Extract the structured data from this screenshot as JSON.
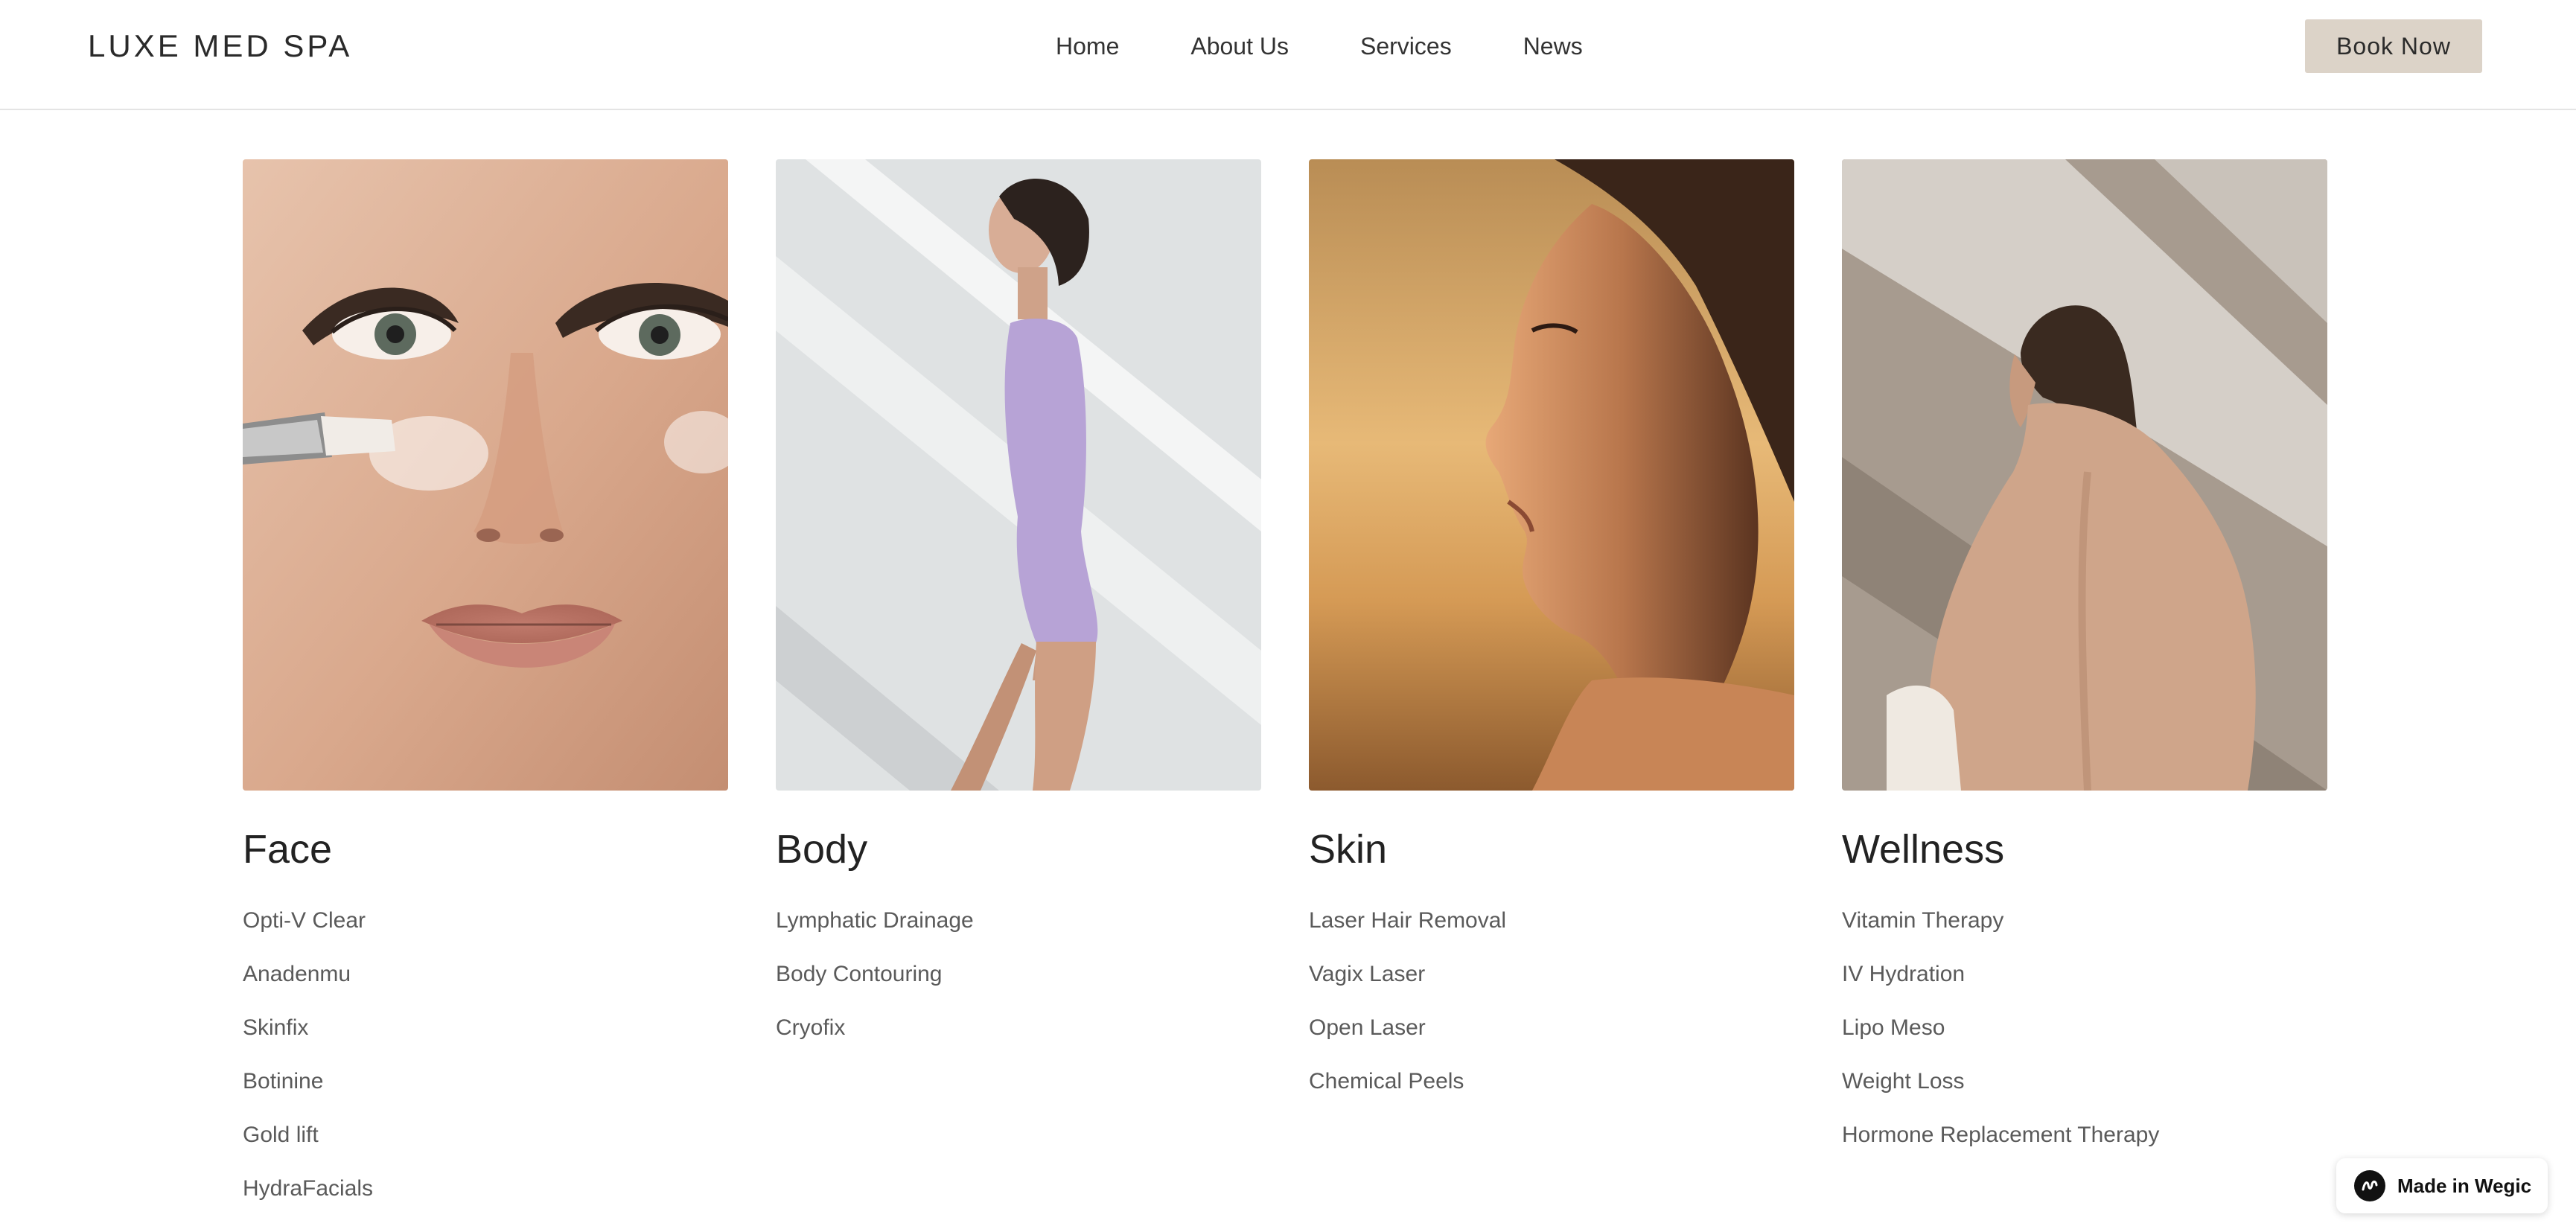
{
  "header": {
    "logo": "LUXE MED SPA",
    "nav": [
      "Home",
      "About Us",
      "Services",
      "News"
    ],
    "cta": "Book Now",
    "cta_color": "#dcd3c8"
  },
  "categories": [
    {
      "title": "Face",
      "image": "woman-face-closeup-skincare-brush",
      "items": [
        "Opti-V Clear",
        "Anadenmu",
        "Skinfix",
        "Botinine",
        "Gold lift",
        "HydraFacials"
      ]
    },
    {
      "title": "Body",
      "image": "woman-lavender-bodysuit-profile",
      "items": [
        "Lymphatic Drainage",
        "Body Contouring",
        "Cryofix"
      ]
    },
    {
      "title": "Skin",
      "image": "woman-profile-golden-light",
      "items": [
        "Laser Hair Removal",
        "Vagix Laser",
        "Open Laser",
        "Chemical Peels"
      ]
    },
    {
      "title": "Wellness",
      "image": "woman-bare-back-sunlight",
      "items": [
        "Vitamin Therapy",
        "IV Hydration",
        "Lipo Meso",
        "Weight Loss",
        "Hormone Replacement Therapy"
      ]
    }
  ],
  "badge": {
    "label": "Made in Wegic",
    "icon": "wegic-logo-icon"
  }
}
